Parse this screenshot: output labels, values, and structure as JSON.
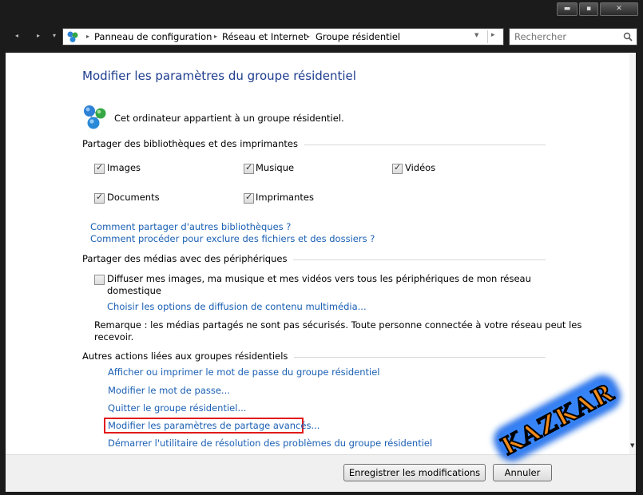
{
  "window": {
    "minimize_glyph": "▬",
    "maximize_glyph": "▪",
    "close_glyph": "✕"
  },
  "navigation": {
    "back_glyph": "◂",
    "forward_glyph": "▸",
    "history_glyph": "▾",
    "breadcrumbs": [
      "Panneau de configuration",
      "Réseau et Internet",
      "Groupe résidentiel"
    ],
    "separator_glyph": "▸",
    "search_placeholder": "Rechercher"
  },
  "icons": {
    "address_icon": "homegroup-icon",
    "homegroup_icon": "homegroup-icon",
    "search_icon": "search-icon"
  },
  "page": {
    "title": "Modifier les paramètres du groupe résidentiel",
    "membership_text": "Cet ordinateur appartient à un groupe résidentiel."
  },
  "libraries": {
    "section_title": "Partager des bibliothèques et des imprimantes",
    "items": [
      {
        "label": "Images",
        "checked": true
      },
      {
        "label": "Musique",
        "checked": true
      },
      {
        "label": "Vidéos",
        "checked": true
      },
      {
        "label": "Documents",
        "checked": true
      },
      {
        "label": "Imprimantes",
        "checked": true
      }
    ],
    "links": [
      "Comment partager d'autres bibliothèques ?",
      "Comment procéder pour exclure des fichiers et des dossiers ?"
    ]
  },
  "media": {
    "section_title": "Partager des médias avec des périphériques",
    "stream_label_line1": "Diffuser mes images, ma musique et mes vidéos vers tous les périphériques de mon réseau",
    "stream_label_line2": "domestique",
    "stream_checked": false,
    "options_link": "Choisir les options de diffusion de contenu multimédia...",
    "note_line1": "Remarque : les médias partagés ne sont pas sécurisés. Toute personne connectée à votre réseau peut les",
    "note_line2": "recevoir."
  },
  "other_actions": {
    "section_title": "Autres actions liées aux groupes résidentiels",
    "links": [
      "Afficher ou imprimer le mot de passe du groupe résidentiel",
      "Modifier le mot de passe...",
      "Quitter le groupe résidentiel...",
      "Modifier les paramètres de partage avancés...",
      "Démarrer l'utilitaire de résolution des problèmes du groupe résidentiel"
    ]
  },
  "footer": {
    "save_label": "Enregistrer les modifications",
    "cancel_label": "Annuler"
  },
  "watermark": {
    "text": "KAZKAR"
  },
  "colors": {
    "title_blue": "#1e3d8f",
    "link_blue": "#1a5fb4",
    "highlight_red": "#e21a1a"
  }
}
